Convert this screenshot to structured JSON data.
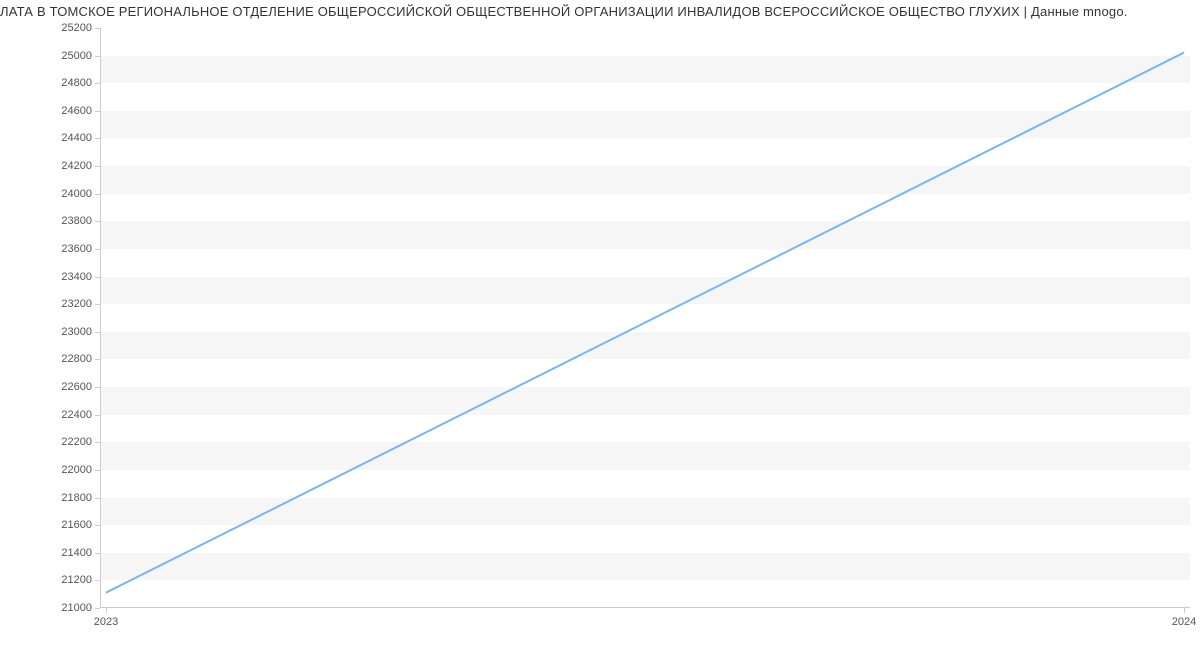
{
  "chart_data": {
    "type": "line",
    "title": "ЛАТА В ТОМСКОЕ РЕГИОНАЛЬНОЕ ОТДЕЛЕНИЕ ОБЩЕРОССИЙСКОЙ ОБЩЕСТВЕННОЙ ОРГАНИЗАЦИИ ИНВАЛИДОВ  ВСЕРОССИЙСКОЕ ОБЩЕСТВО ГЛУХИХ | Данные mnogo.",
    "x": [
      "2023",
      "2024"
    ],
    "values": [
      21111,
      25022
    ],
    "xlabel": "",
    "ylabel": "",
    "ylim": [
      21000,
      25200
    ],
    "y_ticks": [
      21000,
      21200,
      21400,
      21600,
      21800,
      22000,
      22200,
      22400,
      22600,
      22800,
      23000,
      23200,
      23400,
      23600,
      23800,
      24000,
      24200,
      24400,
      24600,
      24800,
      25000,
      25200
    ],
    "x_ticks": [
      "2023",
      "2024"
    ],
    "line_color": "#7cb5ec"
  }
}
